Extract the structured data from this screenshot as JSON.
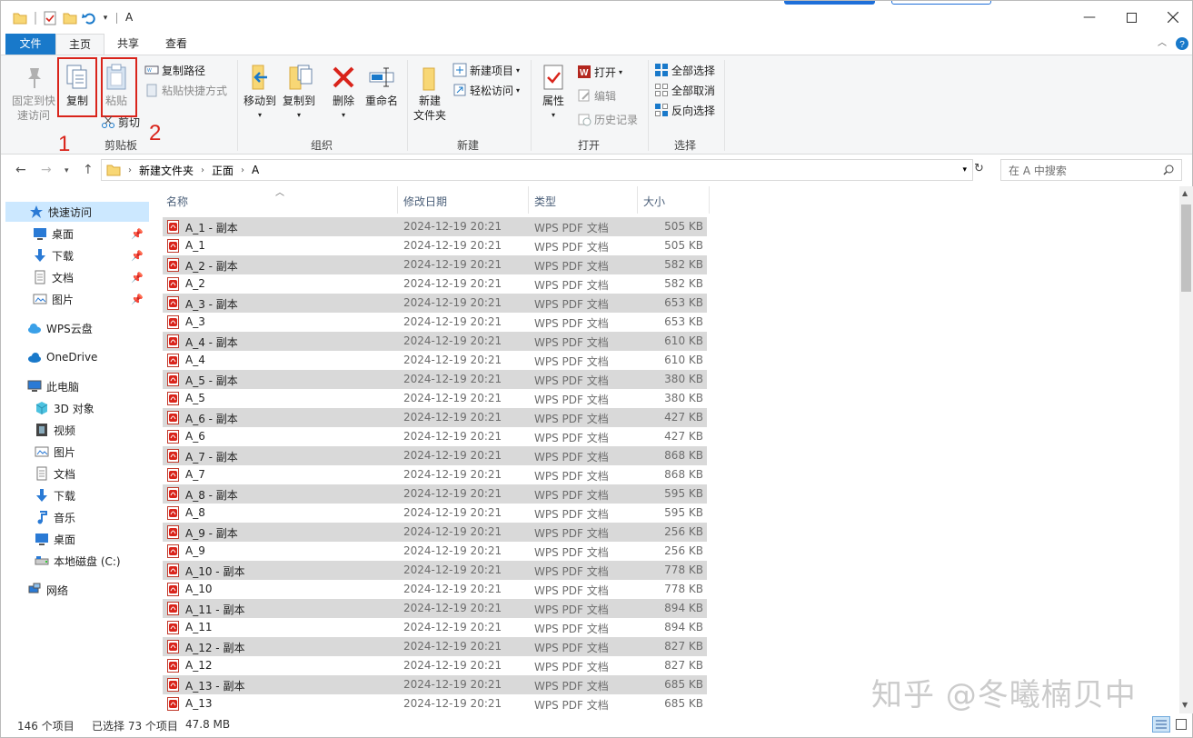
{
  "title": "A",
  "tabs": {
    "file": "文件",
    "home": "主页",
    "share": "共享",
    "view": "查看"
  },
  "ribbon": {
    "pin": "固定到快\n速访问",
    "copy": "复制",
    "paste": "粘贴",
    "copy_path": "复制路径",
    "paste_shortcut": "粘贴快捷方式",
    "cut": "剪切",
    "group_clipboard": "剪贴板",
    "move_to": "移动到",
    "copy_to": "复制到",
    "delete": "删除",
    "rename": "重命名",
    "group_organize": "组织",
    "new_folder": "新建\n文件夹",
    "new_item": "新建项目",
    "easy_access": "轻松访问",
    "group_new": "新建",
    "properties": "属性",
    "open": "打开",
    "edit": "编辑",
    "history": "历史记录",
    "group_open": "打开",
    "select_all": "全部选择",
    "select_none": "全部取消",
    "invert_select": "反向选择",
    "group_select": "选择",
    "annot1": "1",
    "annot2": "2"
  },
  "address": {
    "crumbs": [
      "新建文件夹",
      "正面",
      "A"
    ],
    "search_placeholder": "在 A 中搜索"
  },
  "nav": {
    "quick_access": "快速访问",
    "qa_items": [
      "桌面",
      "下载",
      "文档",
      "图片"
    ],
    "wps": "WPS云盘",
    "onedrive": "OneDrive",
    "thispc": "此电脑",
    "pc_items": [
      "3D 对象",
      "视频",
      "图片",
      "文档",
      "下载",
      "音乐",
      "桌面",
      "本地磁盘 (C:)"
    ],
    "network": "网络"
  },
  "columns": {
    "name": "名称",
    "date": "修改日期",
    "type": "类型",
    "size": "大小"
  },
  "files": [
    {
      "name": "A_1 - 副本",
      "date": "2024-12-19 20:21",
      "type": "WPS PDF 文档",
      "size": "505 KB",
      "selected": true
    },
    {
      "name": "A_1",
      "date": "2024-12-19 20:21",
      "type": "WPS PDF 文档",
      "size": "505 KB",
      "selected": false
    },
    {
      "name": "A_2 - 副本",
      "date": "2024-12-19 20:21",
      "type": "WPS PDF 文档",
      "size": "582 KB",
      "selected": true
    },
    {
      "name": "A_2",
      "date": "2024-12-19 20:21",
      "type": "WPS PDF 文档",
      "size": "582 KB",
      "selected": false
    },
    {
      "name": "A_3 - 副本",
      "date": "2024-12-19 20:21",
      "type": "WPS PDF 文档",
      "size": "653 KB",
      "selected": true
    },
    {
      "name": "A_3",
      "date": "2024-12-19 20:21",
      "type": "WPS PDF 文档",
      "size": "653 KB",
      "selected": false
    },
    {
      "name": "A_4 - 副本",
      "date": "2024-12-19 20:21",
      "type": "WPS PDF 文档",
      "size": "610 KB",
      "selected": true
    },
    {
      "name": "A_4",
      "date": "2024-12-19 20:21",
      "type": "WPS PDF 文档",
      "size": "610 KB",
      "selected": false
    },
    {
      "name": "A_5 - 副本",
      "date": "2024-12-19 20:21",
      "type": "WPS PDF 文档",
      "size": "380 KB",
      "selected": true
    },
    {
      "name": "A_5",
      "date": "2024-12-19 20:21",
      "type": "WPS PDF 文档",
      "size": "380 KB",
      "selected": false
    },
    {
      "name": "A_6 - 副本",
      "date": "2024-12-19 20:21",
      "type": "WPS PDF 文档",
      "size": "427 KB",
      "selected": true
    },
    {
      "name": "A_6",
      "date": "2024-12-19 20:21",
      "type": "WPS PDF 文档",
      "size": "427 KB",
      "selected": false
    },
    {
      "name": "A_7 - 副本",
      "date": "2024-12-19 20:21",
      "type": "WPS PDF 文档",
      "size": "868 KB",
      "selected": true
    },
    {
      "name": "A_7",
      "date": "2024-12-19 20:21",
      "type": "WPS PDF 文档",
      "size": "868 KB",
      "selected": false
    },
    {
      "name": "A_8 - 副本",
      "date": "2024-12-19 20:21",
      "type": "WPS PDF 文档",
      "size": "595 KB",
      "selected": true
    },
    {
      "name": "A_8",
      "date": "2024-12-19 20:21",
      "type": "WPS PDF 文档",
      "size": "595 KB",
      "selected": false
    },
    {
      "name": "A_9 - 副本",
      "date": "2024-12-19 20:21",
      "type": "WPS PDF 文档",
      "size": "256 KB",
      "selected": true
    },
    {
      "name": "A_9",
      "date": "2024-12-19 20:21",
      "type": "WPS PDF 文档",
      "size": "256 KB",
      "selected": false
    },
    {
      "name": "A_10 - 副本",
      "date": "2024-12-19 20:21",
      "type": "WPS PDF 文档",
      "size": "778 KB",
      "selected": true
    },
    {
      "name": "A_10",
      "date": "2024-12-19 20:21",
      "type": "WPS PDF 文档",
      "size": "778 KB",
      "selected": false
    },
    {
      "name": "A_11 - 副本",
      "date": "2024-12-19 20:21",
      "type": "WPS PDF 文档",
      "size": "894 KB",
      "selected": true
    },
    {
      "name": "A_11",
      "date": "2024-12-19 20:21",
      "type": "WPS PDF 文档",
      "size": "894 KB",
      "selected": false
    },
    {
      "name": "A_12 - 副本",
      "date": "2024-12-19 20:21",
      "type": "WPS PDF 文档",
      "size": "827 KB",
      "selected": true
    },
    {
      "name": "A_12",
      "date": "2024-12-19 20:21",
      "type": "WPS PDF 文档",
      "size": "827 KB",
      "selected": false
    },
    {
      "name": "A_13 - 副本",
      "date": "2024-12-19 20:21",
      "type": "WPS PDF 文档",
      "size": "685 KB",
      "selected": true
    },
    {
      "name": "A_13",
      "date": "2024-12-19 20:21",
      "type": "WPS PDF 文档",
      "size": "685 KB",
      "selected": false
    }
  ],
  "status": {
    "count": "146 个项目",
    "selected": "已选择 73 个项目",
    "size": "47.8 MB"
  },
  "watermark": "知乎 @冬曦楠贝中",
  "colors": {
    "accent": "#1979ca",
    "annotation": "#d9241b",
    "selected_row": "#d9d9d9"
  }
}
